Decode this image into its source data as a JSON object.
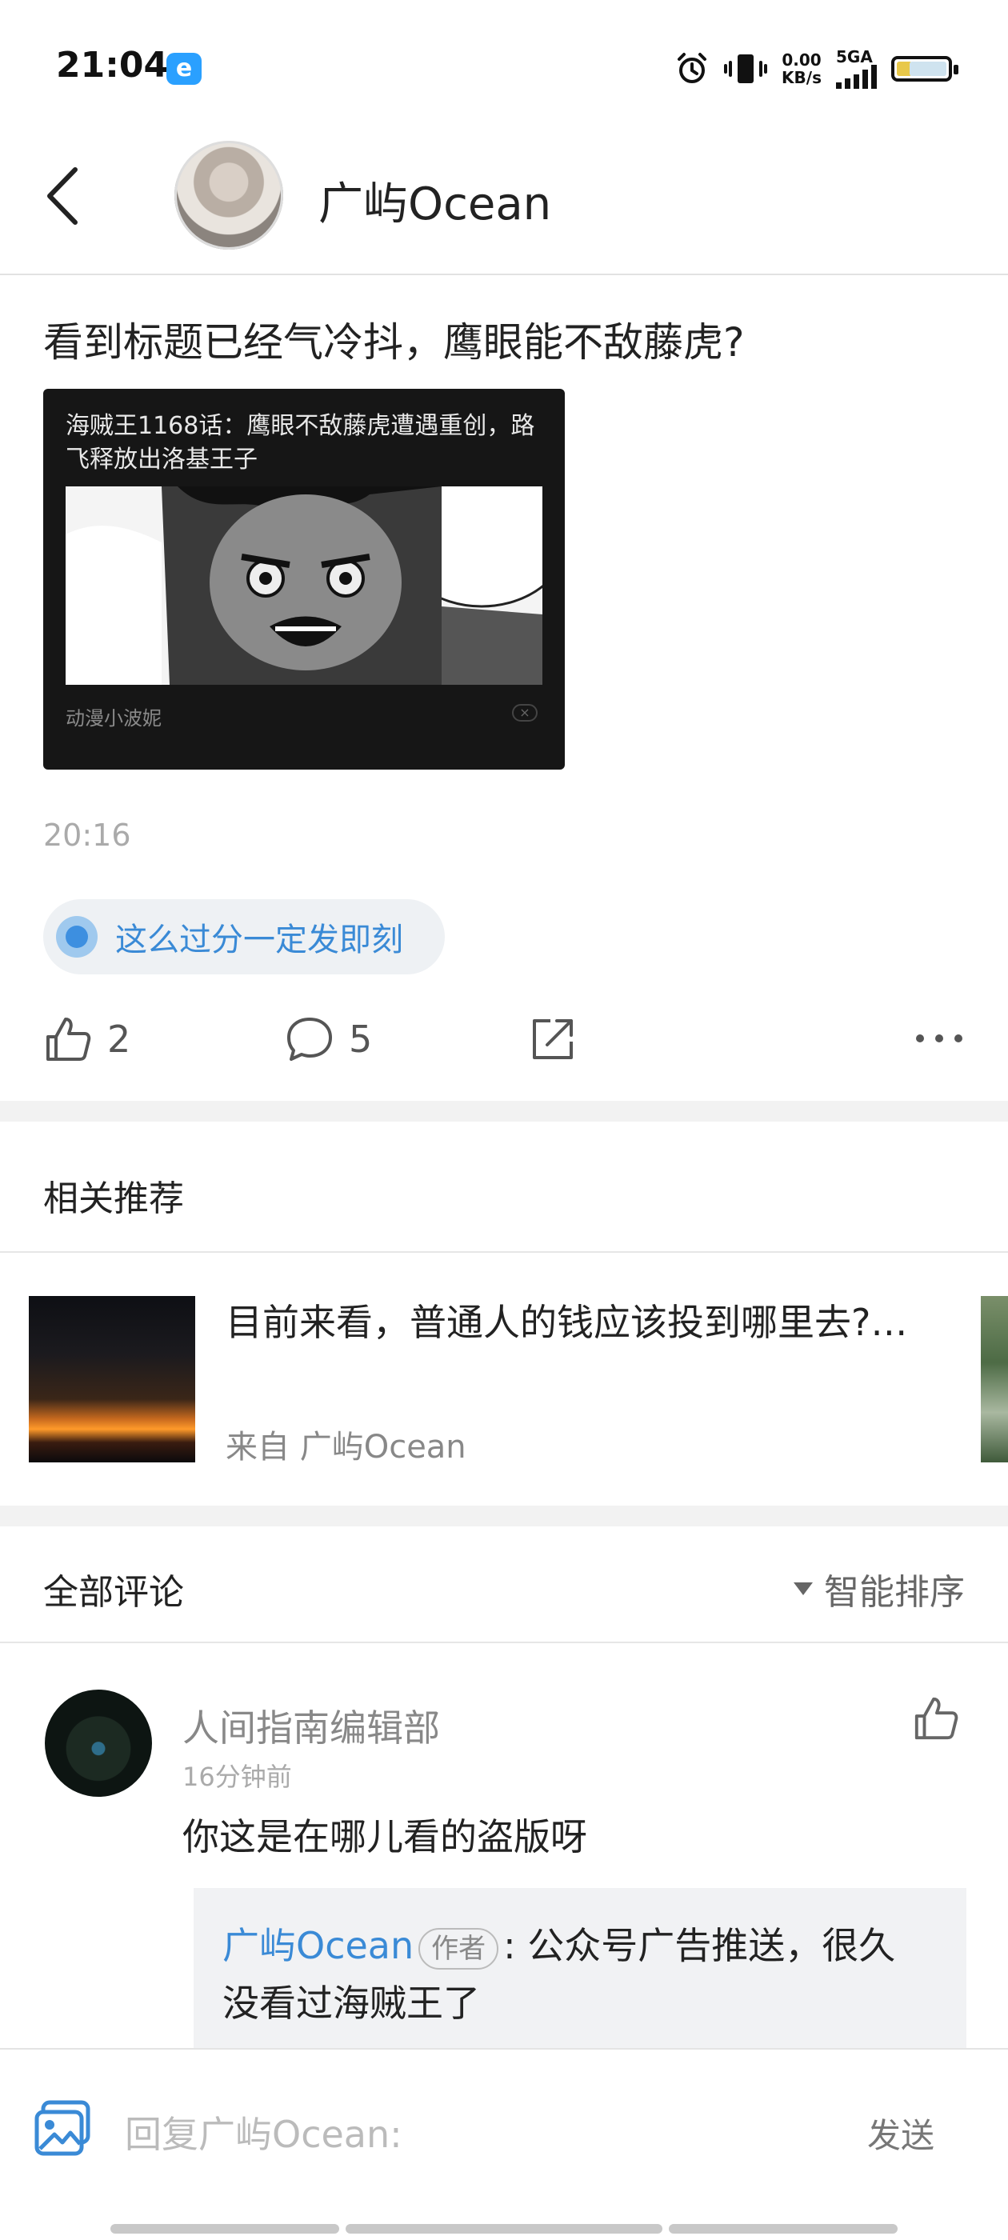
{
  "status_bar": {
    "time": "21:04",
    "app_icon_letter": "e",
    "speed_value": "0.00",
    "speed_unit": "KB/s",
    "network": "5GA"
  },
  "header": {
    "title": "广屿Ocean"
  },
  "post": {
    "text": "看到标题已经气冷抖，鹰眼能不敌藤虎?",
    "card": {
      "title": "海贼王1168话：鹰眼不敌藤虎遭遇重创，路飞释放出洛基王子",
      "source": "动漫小波妮"
    },
    "time": "20:16",
    "topic": "这么过分一定发即刻",
    "likes": "2",
    "comments": "5"
  },
  "recommend": {
    "section_title": "相关推荐",
    "item": {
      "title": "目前来看，普通人的钱应该投到哪里去?…",
      "source": "来自 广屿Ocean"
    }
  },
  "comments_section": {
    "title": "全部评论",
    "sort_label": "智能排序",
    "comment": {
      "author": "人间指南编辑部",
      "time": "16分钟前",
      "text": "你这是在哪儿看的盗版呀",
      "reply": {
        "author": "广屿Ocean",
        "tag": "作者",
        "text": ": 公众号广告推送，很久没看过海贼王了"
      }
    }
  },
  "bottom_bar": {
    "placeholder": "回复广屿Ocean:",
    "send_label": "发送"
  },
  "colors": {
    "accent_blue": "#3a8ad6",
    "topic_bg": "#eef1f4",
    "card_bg": "#161616"
  }
}
